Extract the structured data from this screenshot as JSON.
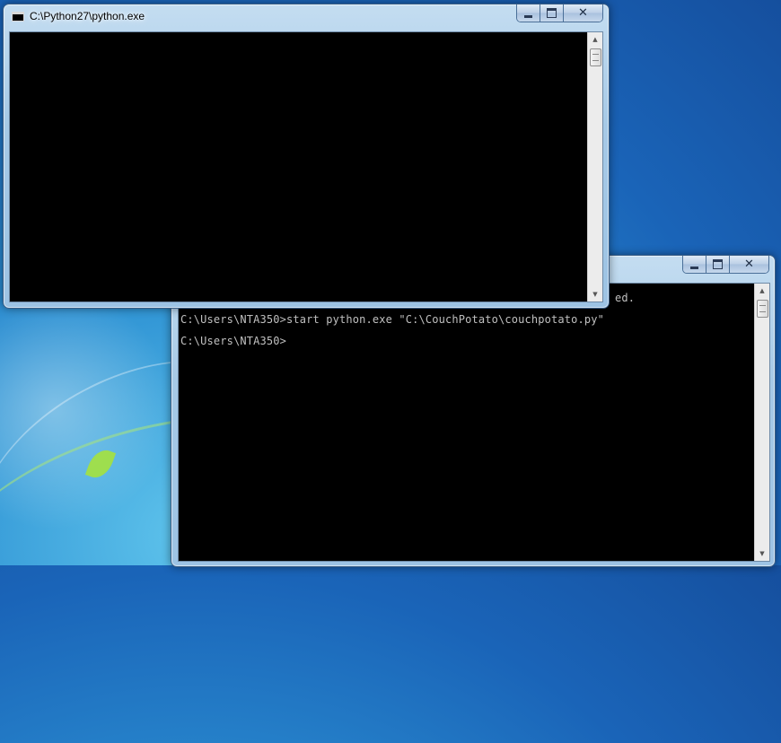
{
  "desktop": {
    "theme": "Windows 7"
  },
  "console_front": {
    "title": "C:\\Python27\\python.exe",
    "lines": [],
    "caption": {
      "minimize": "minimize-icon",
      "maximize": "maximize-icon",
      "close": "✕"
    },
    "scroll": {
      "up": "▲",
      "down": "▼"
    }
  },
  "console_back": {
    "title": "",
    "lines": [
      "ed.",
      "C:\\Users\\NTA350>start python.exe \"C:\\CouchPotato\\couchpotato.py\"",
      "C:\\Users\\NTA350>"
    ],
    "caption": {
      "minimize": "minimize-icon",
      "maximize": "maximize-icon",
      "close": "✕"
    },
    "scroll": {
      "up": "▲",
      "down": "▼"
    }
  },
  "colors": {
    "console_background": "#000000",
    "console_text": "#c0c0c0",
    "aero_frame": "#a6c9e6"
  }
}
